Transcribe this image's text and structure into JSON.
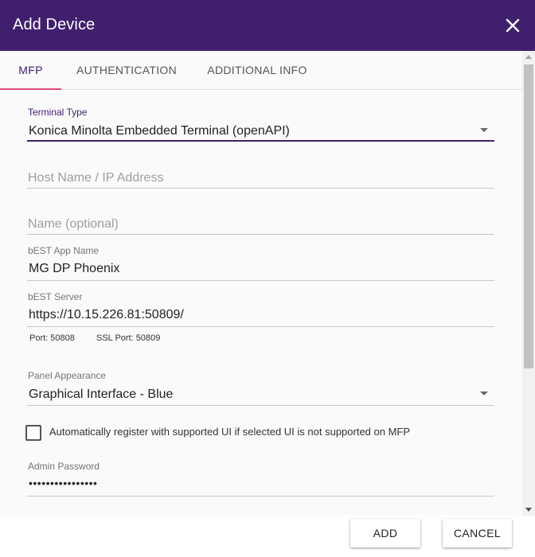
{
  "dialog": {
    "title": "Add Device",
    "close_icon": "close-icon"
  },
  "tabs": [
    {
      "label": "MFP",
      "active": true
    },
    {
      "label": "AUTHENTICATION",
      "active": false
    },
    {
      "label": "ADDITIONAL INFO",
      "active": false
    }
  ],
  "form": {
    "terminal_type": {
      "label": "Terminal Type",
      "value": "Konica Minolta Embedded Terminal (openAPI)"
    },
    "host": {
      "placeholder": "Host Name / IP Address",
      "value": ""
    },
    "name": {
      "placeholder": "Name (optional)",
      "value": ""
    },
    "app_name": {
      "label": "bEST App Name",
      "value": "MG DP Phoenix"
    },
    "server": {
      "label": "bEST Server",
      "value": "https://10.15.226.81:50809/"
    },
    "port": "Port: 50808",
    "ssl_port": "SSL Port: 50809",
    "panel": {
      "label": "Panel Appearance",
      "value": "Graphical Interface - Blue"
    },
    "auto_register": {
      "label": "Automatically register with supported UI if selected UI is not supported on MFP",
      "checked": false
    },
    "admin_password": {
      "label": "Admin Password",
      "value": "••••••••••••••••"
    }
  },
  "buttons": {
    "add": "ADD",
    "cancel": "CANCEL"
  },
  "colors": {
    "header": "#40206e",
    "tab_indicator": "#e0457b",
    "focus": "#40206e"
  }
}
